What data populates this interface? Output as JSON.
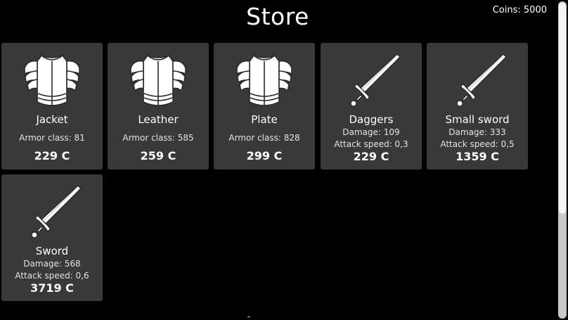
{
  "header": {
    "title": "Store",
    "coins": "Coins: 5000"
  },
  "items": [
    {
      "name": "Jacket",
      "icon": "armor-icon",
      "type": "armor",
      "stat1": "Armor class: 81",
      "price": "229 C"
    },
    {
      "name": "Leather",
      "icon": "armor-icon",
      "type": "armor",
      "stat1": "Armor class: 585",
      "price": "259 C"
    },
    {
      "name": "Plate",
      "icon": "armor-icon",
      "type": "armor",
      "stat1": "Armor class: 828",
      "price": "299 C"
    },
    {
      "name": "Daggers",
      "icon": "sword-icon",
      "type": "weapon",
      "stat1": "Damage: 109",
      "stat2": "Attack speed: 0,3",
      "price": "229 C"
    },
    {
      "name": "Small sword",
      "icon": "sword-icon",
      "type": "weapon",
      "stat1": "Damage: 333",
      "stat2": "Attack speed: 0,5",
      "price": "1359 C"
    },
    {
      "name": "Sword",
      "icon": "sword-icon",
      "type": "weapon",
      "stat1": "Damage: 568",
      "stat2": "Attack speed: 0,6",
      "price": "3719 C"
    }
  ],
  "colors": {
    "background": "#000000",
    "card": "#393939",
    "text": "#ffffff"
  }
}
